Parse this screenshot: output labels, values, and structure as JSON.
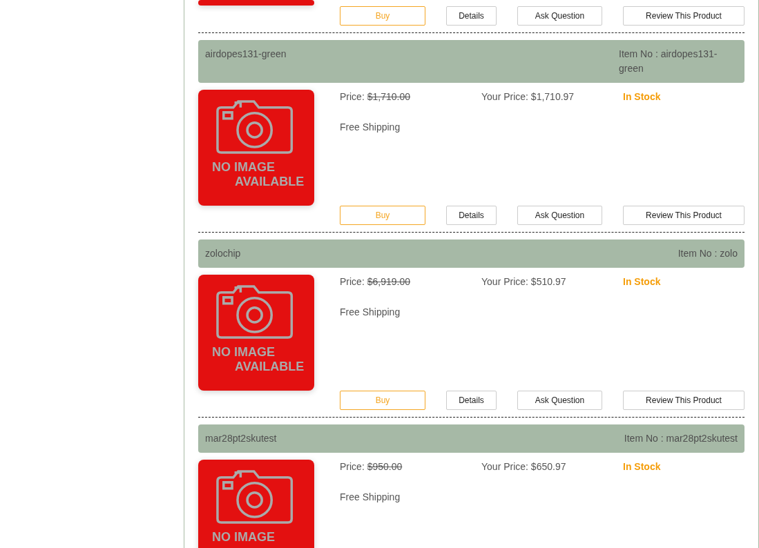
{
  "top_fragment": {
    "buttons": [
      {
        "label": "Buy",
        "kind": "buy"
      },
      {
        "label": "Details",
        "kind": "plain"
      },
      {
        "label": "Ask Question",
        "kind": "plain"
      },
      {
        "label": "Review This Product",
        "kind": "plain"
      }
    ]
  },
  "products": [
    {
      "name": "airdopes131-green",
      "item_no": "Item No : airdopes131-green",
      "price_label": "Price:",
      "price": "$1,710.00",
      "your_price": "Your Price: $1,710.97",
      "stock": "In Stock",
      "in_stock": true,
      "shipping": "Free Shipping",
      "image_text": [
        "NO IMAGE",
        "AVAILABLE"
      ],
      "buttons": [
        {
          "label": "Buy",
          "kind": "buy"
        },
        {
          "label": "Details",
          "kind": "plain"
        },
        {
          "label": "Ask Question",
          "kind": "plain"
        },
        {
          "label": "Review This Product",
          "kind": "plain"
        }
      ]
    },
    {
      "name": "zolochip",
      "item_no": "Item No : zolo",
      "price_label": "Price:",
      "price": "$6,919.00",
      "your_price": "Your Price: $510.97",
      "stock": "In Stock",
      "in_stock": true,
      "shipping": "Free Shipping",
      "image_text": [
        "NO IMAGE",
        "AVAILABLE"
      ],
      "buttons": [
        {
          "label": "Buy",
          "kind": "buy"
        },
        {
          "label": "Details",
          "kind": "plain"
        },
        {
          "label": "Ask Question",
          "kind": "plain"
        },
        {
          "label": "Review This Product",
          "kind": "plain"
        }
      ]
    },
    {
      "name": "mar28pt2skutest",
      "item_no": "Item No : mar28pt2skutest",
      "price_label": "Price:",
      "price": "$950.00",
      "your_price": "Your Price: $650.97",
      "stock": "In Stock",
      "in_stock": true,
      "shipping": "Free Shipping",
      "image_text": [
        "NO IMAGE"
      ]
    }
  ]
}
